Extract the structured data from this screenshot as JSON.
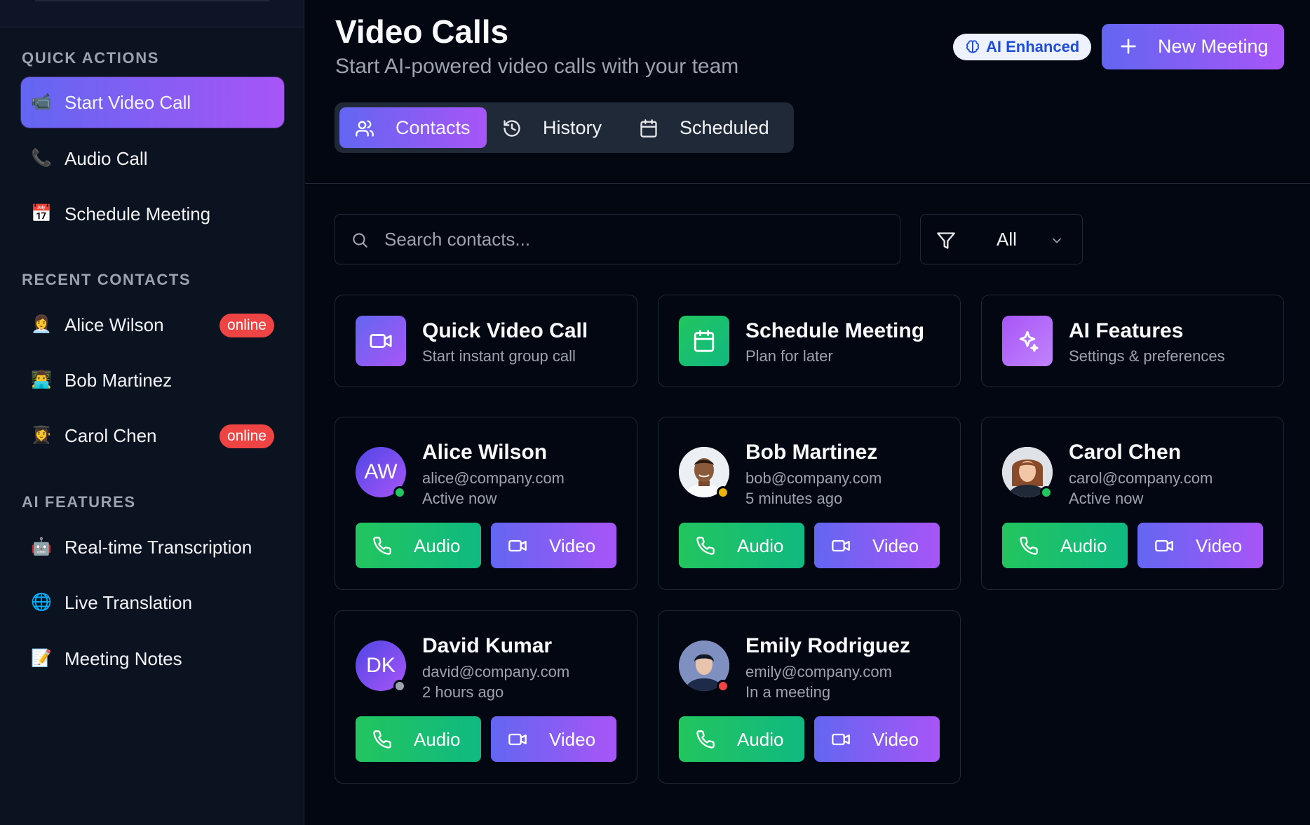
{
  "sidebar": {
    "sections": [
      {
        "title": "QUICK ACTIONS"
      },
      {
        "title": "RECENT CONTACTS"
      },
      {
        "title": "AI FEATURES"
      }
    ],
    "quick_actions": [
      {
        "icon": "video-camera-icon",
        "emoji": "📹",
        "label": "Start Video Call"
      },
      {
        "icon": "phone-icon",
        "emoji": "📞",
        "label": "Audio Call"
      },
      {
        "icon": "calendar-icon",
        "emoji": "📅",
        "label": "Schedule Meeting"
      }
    ],
    "recent_contacts": [
      {
        "emoji": "👩‍💼",
        "label": "Alice Wilson",
        "badge": "online"
      },
      {
        "emoji": "👨‍💻",
        "label": "Bob Martinez",
        "badge": ""
      },
      {
        "emoji": "👩‍🎓",
        "label": "Carol Chen",
        "badge": "online"
      }
    ],
    "ai_features": [
      {
        "emoji": "🤖",
        "label": "Real-time Transcription"
      },
      {
        "emoji": "🌐",
        "label": "Live Translation"
      },
      {
        "emoji": "📝",
        "label": "Meeting Notes"
      }
    ]
  },
  "header": {
    "title": "Video Calls",
    "subtitle": "Start AI-powered video calls with your team",
    "ai_badge": "AI Enhanced",
    "new_meeting": "New Meeting"
  },
  "tabs": [
    {
      "label": "Contacts",
      "icon": "users-icon",
      "active": true
    },
    {
      "label": "History",
      "icon": "history-icon",
      "active": false
    },
    {
      "label": "Scheduled",
      "icon": "calendar-icon",
      "active": false
    }
  ],
  "search": {
    "placeholder": "Search contacts...",
    "value": ""
  },
  "filter": {
    "value": "All"
  },
  "quick_cards": [
    {
      "title": "Quick Video Call",
      "subtitle": "Start instant group call",
      "icon": "video-camera-icon",
      "color": "#6366f1"
    },
    {
      "title": "Schedule Meeting",
      "subtitle": "Plan for later",
      "icon": "calendar-icon",
      "color": "#22c55e"
    },
    {
      "title": "AI Features",
      "subtitle": "Settings & preferences",
      "icon": "sparkles-icon",
      "color": "#a855f7"
    }
  ],
  "contacts": [
    {
      "initials": "AW",
      "name": "Alice Wilson",
      "email": "alice@company.com",
      "status": "Active now",
      "status_color": "#22c55e",
      "photo": false
    },
    {
      "initials": "",
      "name": "Bob Martinez",
      "email": "bob@company.com",
      "status": "5 minutes ago",
      "status_color": "#eab308",
      "photo": true
    },
    {
      "initials": "",
      "name": "Carol Chen",
      "email": "carol@company.com",
      "status": "Active now",
      "status_color": "#22c55e",
      "photo": true
    },
    {
      "initials": "DK",
      "name": "David Kumar",
      "email": "david@company.com",
      "status": "2 hours ago",
      "status_color": "#9ca3af",
      "photo": false
    },
    {
      "initials": "",
      "name": "Emily Rodriguez",
      "email": "emily@company.com",
      "status": "In a meeting",
      "status_color": "#ef4444",
      "photo": true
    }
  ],
  "buttons": {
    "audio": "Audio",
    "video": "Video"
  },
  "colors": {
    "accent_start": "#6366f1",
    "accent_end": "#a855f7",
    "green": "#22c55e",
    "danger": "#ef4444"
  }
}
